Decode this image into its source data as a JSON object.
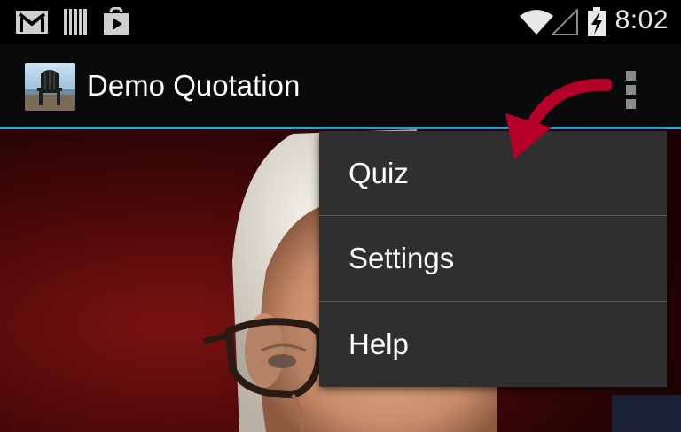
{
  "statusbar": {
    "icons": [
      "gmail-icon",
      "barcode-icon",
      "play-store-icon",
      "wifi-icon",
      "signal-icon",
      "battery-charging-icon"
    ],
    "time": "8:02"
  },
  "actionbar": {
    "title": "Demo Quotation",
    "accent_color": "#33a3d6"
  },
  "overflow_menu": {
    "items": [
      {
        "label": "Quiz"
      },
      {
        "label": "Settings"
      },
      {
        "label": "Help"
      }
    ],
    "background": "#2f2f2f"
  },
  "annotation": {
    "arrow_color": "#b5002a"
  }
}
